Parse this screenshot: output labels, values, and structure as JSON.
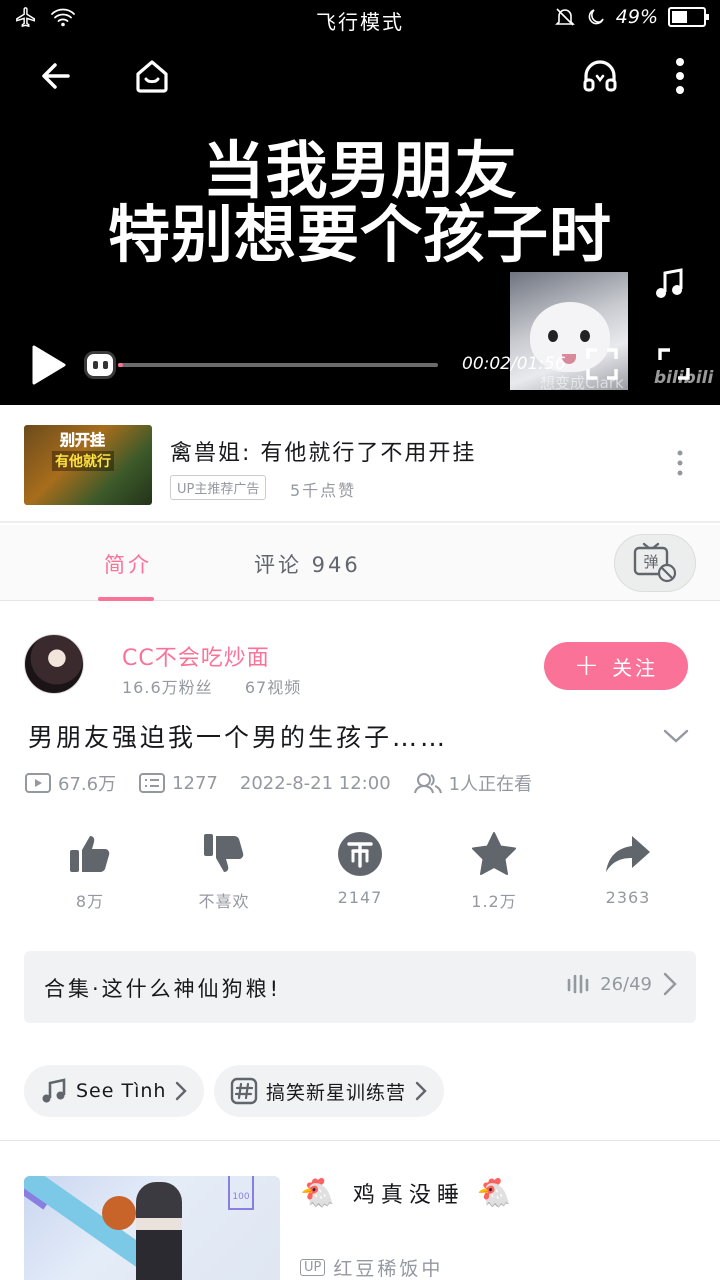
{
  "status_bar": {
    "center_text": "飞行模式",
    "battery": "49%",
    "battery_level": 0.49
  },
  "video": {
    "caption_line1": "当我男朋友",
    "caption_line2": "特别想要个孩子时",
    "time": "00:02/01:56",
    "progress": 0.017,
    "watermark": "想变成Clark",
    "brand_watermark": "bilibili"
  },
  "ad": {
    "thumb_text1": "别开挂",
    "thumb_text2": "有他就行",
    "title": "禽兽姐: 有他就行了不用开挂",
    "tag": "UP主推荐广告",
    "views": "5千点赞"
  },
  "tabs": {
    "intro": "简介",
    "comments": "评论 946",
    "danmaku_glyph": "弹"
  },
  "uploader": {
    "name": "CC不会吃炒面",
    "fans": "16.6万粉丝",
    "videos": "67视频",
    "follow_label": "关注"
  },
  "video_info": {
    "title": "男朋友强迫我一个男的生孩子……",
    "views": "67.6万",
    "danmaku_count": "1277",
    "date": "2022-8-21 12:00",
    "watching": "1人正在看"
  },
  "actions": {
    "like": "8万",
    "dislike": "不喜欢",
    "coin": "2147",
    "favorite": "1.2万",
    "share": "2363"
  },
  "collection": {
    "title": "合集·这什么神仙狗粮!",
    "count": "26/49"
  },
  "tags": {
    "music": "See Tình",
    "topic": "搞笑新星训练营"
  },
  "recommended": {
    "title": "鸡真没睡",
    "title_emoji": "🐔",
    "badge_text": "100",
    "up_badge": "UP",
    "up_name": "红豆稀饭中"
  },
  "colors": {
    "accent": "#fb7299",
    "muted": "#9499a0",
    "text": "#18191c"
  }
}
